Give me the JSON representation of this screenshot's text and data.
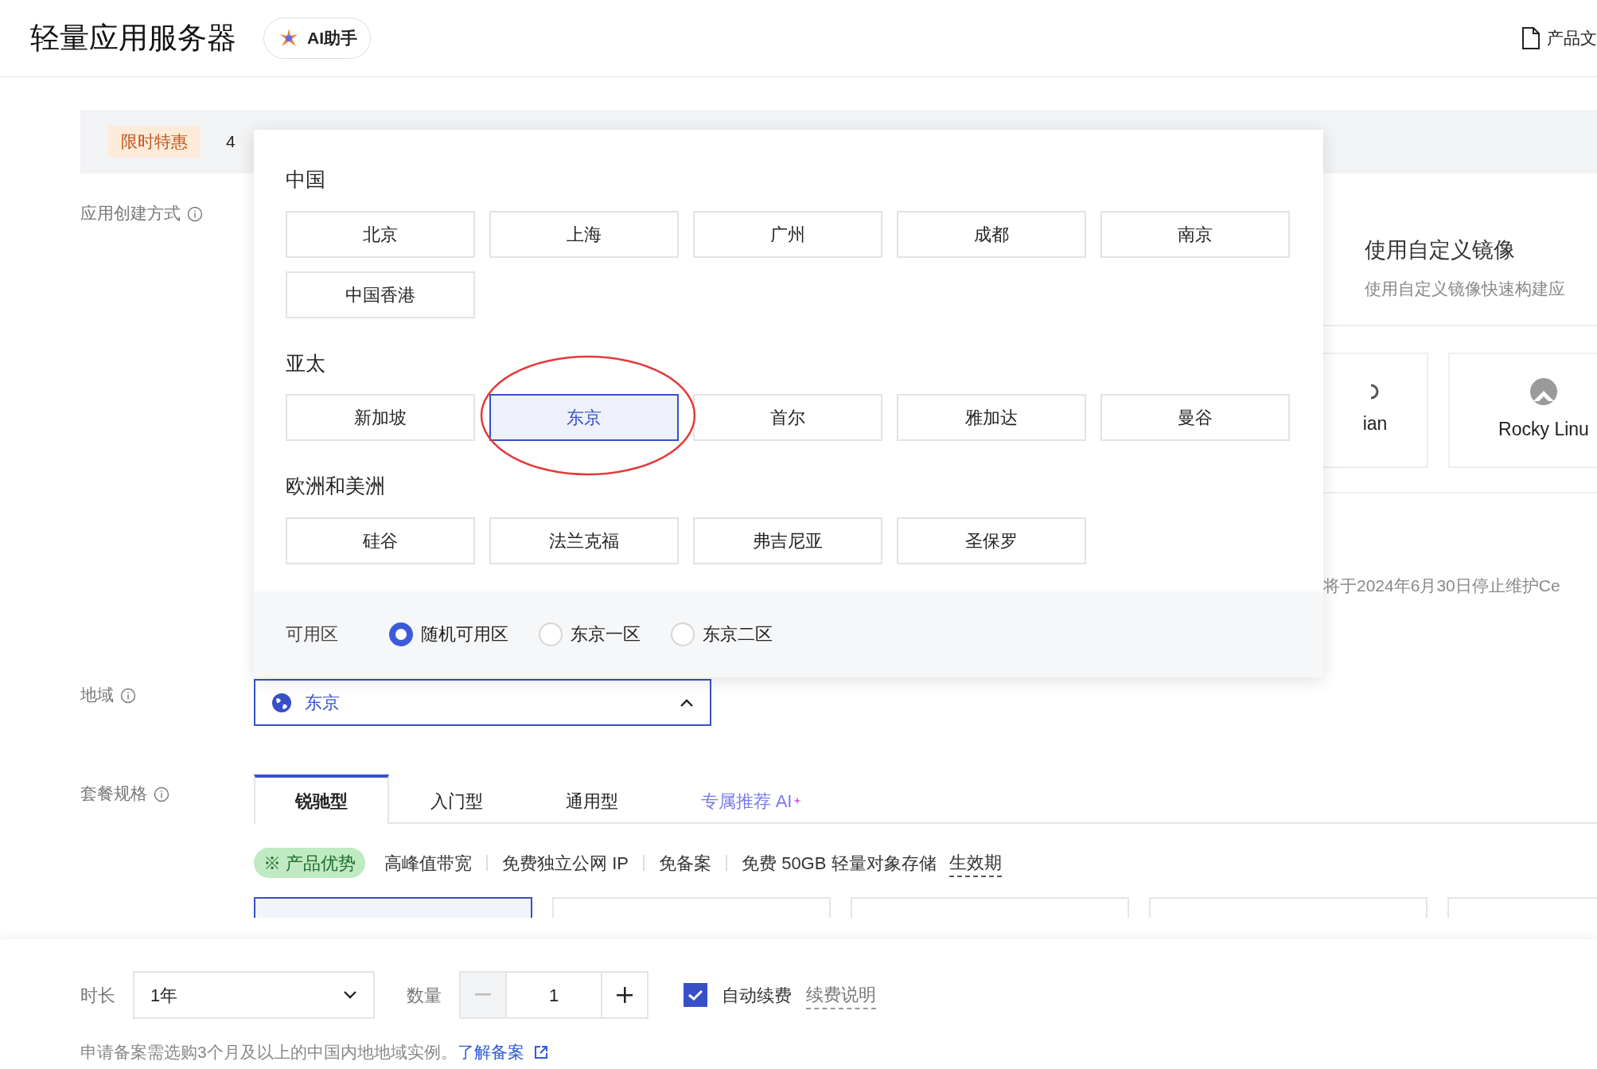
{
  "header": {
    "title": "轻量应用服务器",
    "ai_button": "AI助手",
    "docs_link": "产品文"
  },
  "promo": {
    "badge": "限时特惠",
    "text": "4"
  },
  "creation": {
    "label": "应用创建方式",
    "custom_image": {
      "title": "使用自定义镜像",
      "subtitle": "使用自定义镜像快速构建应"
    },
    "images": [
      {
        "name": "ian"
      },
      {
        "name": "Rocky Linu"
      }
    ],
    "notice": "将于2024年6月30日停止维护Ce"
  },
  "region_dropdown": {
    "groups": [
      {
        "name": "中国",
        "options": [
          {
            "label": "北京",
            "selected": false
          },
          {
            "label": "上海",
            "selected": false
          },
          {
            "label": "广州",
            "selected": false
          },
          {
            "label": "成都",
            "selected": false
          },
          {
            "label": "南京",
            "selected": false
          },
          {
            "label": "中国香港",
            "selected": false
          }
        ]
      },
      {
        "name": "亚太",
        "options": [
          {
            "label": "新加坡",
            "selected": false
          },
          {
            "label": "东京",
            "selected": true
          },
          {
            "label": "首尔",
            "selected": false
          },
          {
            "label": "雅加达",
            "selected": false
          },
          {
            "label": "曼谷",
            "selected": false
          }
        ]
      },
      {
        "name": "欧洲和美洲",
        "options": [
          {
            "label": "硅谷",
            "selected": false
          },
          {
            "label": "法兰克福",
            "selected": false
          },
          {
            "label": "弗吉尼亚",
            "selected": false
          },
          {
            "label": "圣保罗",
            "selected": false
          }
        ]
      }
    ],
    "zone": {
      "label": "可用区",
      "options": [
        {
          "label": "随机可用区",
          "selected": true
        },
        {
          "label": "东京一区",
          "selected": false
        },
        {
          "label": "东京二区",
          "selected": false
        }
      ]
    }
  },
  "region": {
    "label": "地域",
    "value": "东京",
    "expanded": true
  },
  "plan": {
    "label": "套餐规格",
    "tabs": [
      {
        "label": "锐驰型",
        "selected": true,
        "kind": "plain"
      },
      {
        "label": "入门型",
        "selected": false,
        "kind": "plain"
      },
      {
        "label": "通用型",
        "selected": false,
        "kind": "plain"
      },
      {
        "label": "专属推荐 AI",
        "selected": false,
        "kind": "ai"
      }
    ],
    "features": {
      "badge": "※ 产品优势",
      "items": [
        "高峰值带宽",
        "免费独立公网 IP",
        "免备案",
        "免费 50GB 轻量对象存储"
      ],
      "link": "生效期"
    },
    "cards": [
      {
        "selected": true
      },
      {
        "selected": false
      },
      {
        "selected": false
      },
      {
        "selected": false
      },
      {
        "selected": false
      }
    ]
  },
  "purchase": {
    "duration": {
      "label": "时长",
      "value": "1年"
    },
    "quantity": {
      "label": "数量",
      "value": "1"
    },
    "auto_renew": {
      "label": "自动续费",
      "checked": true
    },
    "renew_link": "续费说明",
    "note": "申请备案需选购3个月及以上的中国内地地域实例。",
    "note_link": "了解备案"
  }
}
